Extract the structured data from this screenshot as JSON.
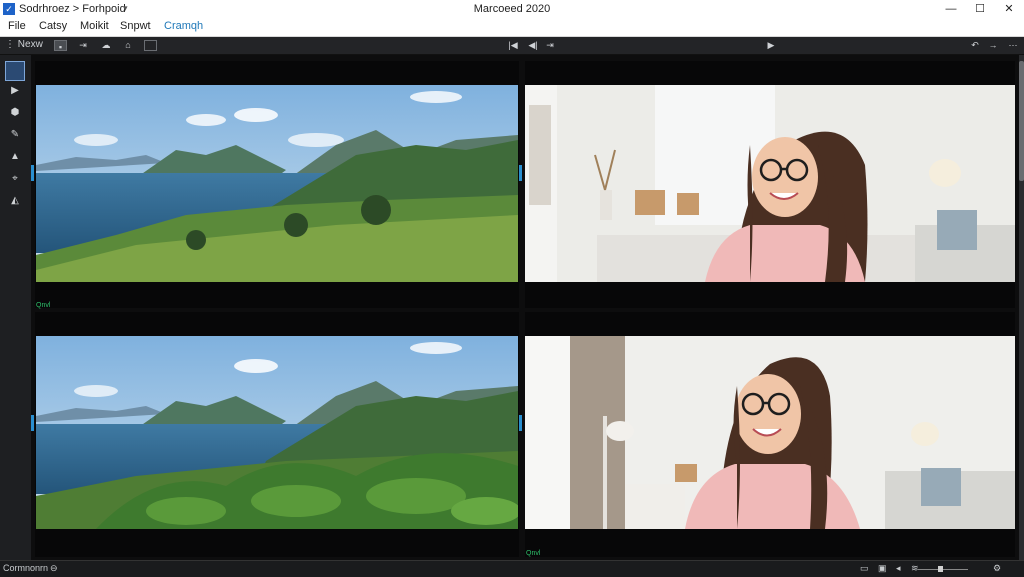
{
  "titlebar": {
    "app_title": "Sodrhroez > Forhpoid",
    "window_title": "Marcoeed 2020",
    "minimize": "—",
    "maximize": "☐",
    "close": "✕"
  },
  "menu": {
    "items": [
      "File",
      "Catsy",
      "Moikit",
      "Snpwt",
      "Cramqh"
    ],
    "active_index": 4
  },
  "toolbar": {
    "new_label": "Nexw",
    "prev_icon": "skip-back-icon",
    "play_icon": "play-icon"
  },
  "tools": [
    "select-tool-icon",
    "play-tool-icon",
    "shape-tool-icon",
    "pen-tool-icon",
    "warning-tool-icon",
    "crop-tool-icon",
    "fill-tool-icon"
  ],
  "panels": [
    {
      "name": "landscape-top",
      "marker": "Qnvl",
      "content": "mountain lake landscape"
    },
    {
      "name": "portrait-top",
      "marker": "",
      "content": "smiling woman with glasses"
    },
    {
      "name": "landscape-bottom",
      "marker": "",
      "content": "mountain lake landscape with leafy plants"
    },
    {
      "name": "portrait-bottom",
      "marker": "Qnvl",
      "content": "smiling woman with glasses"
    }
  ],
  "status": {
    "left_text": "Cormnonrn",
    "icons": [
      "layout-icon",
      "save-icon",
      "speaker-icon",
      "clip-icon",
      "mute-icon",
      "volume-slider",
      "gear-icon"
    ]
  },
  "colors": {
    "accent": "#1f78b8",
    "selection": "#2b4a73",
    "marker_green": "#2ec06a",
    "panel_bg": "#070708"
  }
}
